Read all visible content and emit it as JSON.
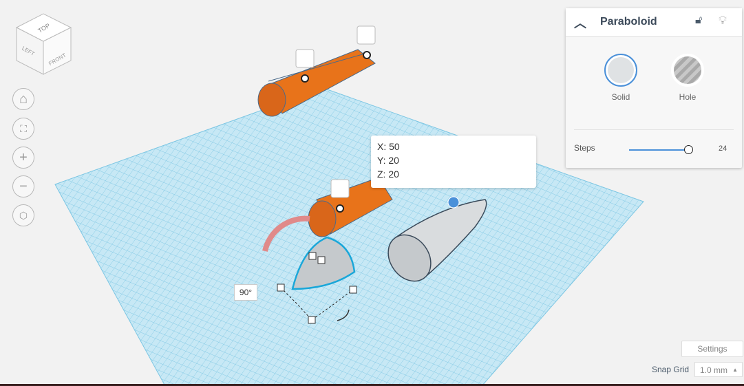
{
  "viewcube": {
    "top": "TOP",
    "left": "LEFT",
    "front": "FRONT"
  },
  "nav": [
    "home-icon",
    "fit-icon",
    "zoom-in-icon",
    "zoom-out-icon",
    "perspective-icon"
  ],
  "panel": {
    "title": "Paraboloid",
    "solid_label": "Solid",
    "hole_label": "Hole",
    "steps_label": "Steps",
    "steps_value": "24",
    "steps_fraction": 1.0
  },
  "tooltip": {
    "x": "X: 50",
    "y": "Y: 20",
    "z": "Z: 20"
  },
  "rotation": {
    "angle": "90°"
  },
  "footer": {
    "settings": "Settings",
    "snap_label": "Snap Grid",
    "snap_value": "1.0 mm"
  },
  "colors": {
    "grid": "#9fd6ec",
    "orange": "#e8731a",
    "accent": "#4a90d9"
  }
}
